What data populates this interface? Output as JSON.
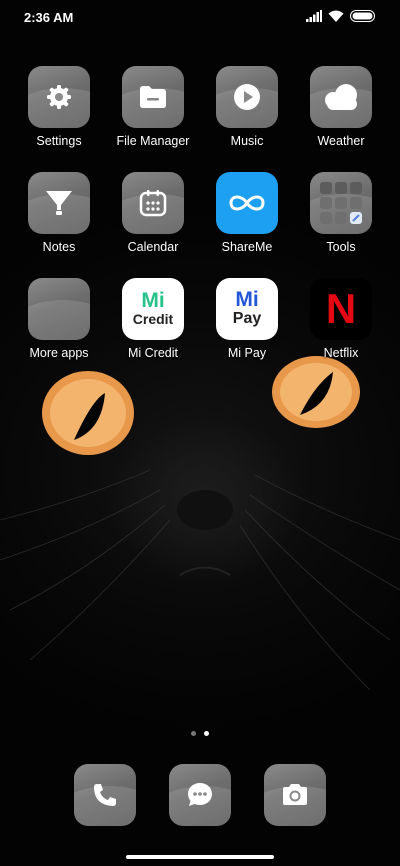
{
  "status": {
    "time": "2:36 AM"
  },
  "apps": [
    {
      "label": "Settings",
      "icon": "gear-icon"
    },
    {
      "label": "File Manager",
      "icon": "folder-icon"
    },
    {
      "label": "Music",
      "icon": "play-icon"
    },
    {
      "label": "Weather",
      "icon": "cloud-icon"
    },
    {
      "label": "Notes",
      "icon": "notes-icon"
    },
    {
      "label": "Calendar",
      "icon": "calendar-icon"
    },
    {
      "label": "ShareMe",
      "icon": "infinity-icon"
    },
    {
      "label": "Tools",
      "icon": "tools-folder-icon"
    },
    {
      "label": "More apps",
      "icon": "more-apps-folder-icon"
    },
    {
      "label": "Mi Credit",
      "icon": "mi-credit-logo",
      "logo_top": "Mi",
      "logo_bottom": "Credit"
    },
    {
      "label": "Mi Pay",
      "icon": "mi-pay-logo",
      "logo_top": "Mi",
      "logo_bottom": "Pay"
    },
    {
      "label": "Netflix",
      "icon": "netflix-logo",
      "logo": "N"
    }
  ],
  "dock": [
    {
      "icon": "phone-icon"
    },
    {
      "icon": "messages-icon"
    },
    {
      "icon": "camera-icon"
    }
  ],
  "pages": {
    "count": 2,
    "current": 2
  },
  "colors": {
    "shareme": "#1ea0f2",
    "netflix": "#e50914",
    "mi_green": "#27c28a",
    "mi_blue": "#2457d6",
    "cat_eye": "#f0a050"
  }
}
